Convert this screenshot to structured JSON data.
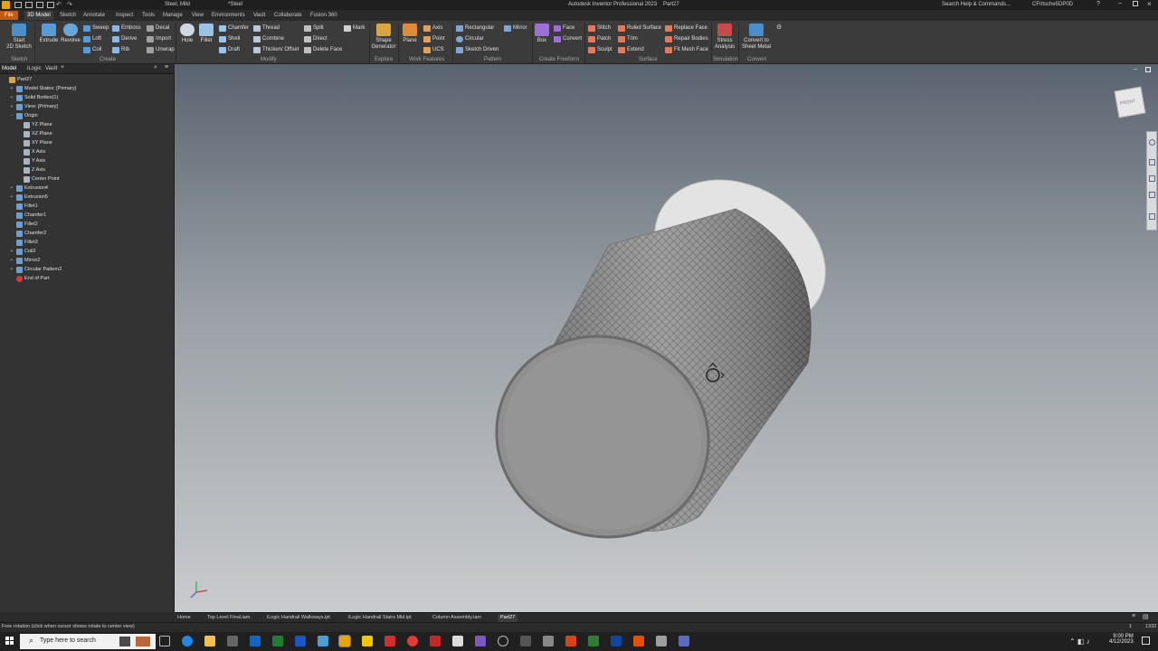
{
  "titlebar": {
    "material": "Steel, Mild",
    "appearance": "*Steel",
    "app_title": "Autodesk Inventor Professional 2023",
    "doc_title": "Part27",
    "search_placeholder": "Search Help & Commands...",
    "user": "CFritsche5DP0D"
  },
  "ribbon_tabs": [
    "File",
    "3D Model",
    "Sketch",
    "Annotate",
    "Inspect",
    "Tools",
    "Manage",
    "View",
    "Environments",
    "Vault",
    "Collaborate",
    "Fusion 360"
  ],
  "ribbon": {
    "sketch": {
      "start_label1": "Start",
      "start_label2": "2D Sketch",
      "group": "Sketch"
    },
    "create": {
      "extrude": "Extrude",
      "revolve": "Revolve",
      "sweep": "Sweep",
      "loft": "Loft",
      "coil": "Coil",
      "emboss": "Emboss",
      "derive": "Derive",
      "rib": "Rib",
      "decal": "Decal",
      "import": "Import",
      "unwrap": "Unwrap",
      "group": "Create"
    },
    "modify": {
      "hole": "Hole",
      "fillet": "Fillet",
      "chamfer": "Chamfer",
      "shell": "Shell",
      "draft": "Draft",
      "thread": "Thread",
      "combine": "Combine",
      "thicken": "Thicken/ Offset",
      "split": "Split",
      "direct": "Direct",
      "delete_face": "Delete Face",
      "mark": "Mark",
      "group": "Modify"
    },
    "explore": {
      "shape_gen1": "Shape",
      "shape_gen2": "Generator",
      "group": "Explore"
    },
    "work": {
      "plane": "Plane",
      "axis": "Axis",
      "point": "Point",
      "ucs": "UCS",
      "group": "Work Features"
    },
    "pattern": {
      "rectangular": "Rectangular",
      "circular": "Circular",
      "sketch_driven": "Sketch Driven",
      "mirror": "Mirror",
      "group": "Pattern"
    },
    "freeform": {
      "box": "Box",
      "face": "Face",
      "convert": "Convert",
      "group": "Create Freeform"
    },
    "surface": {
      "stitch": "Stitch",
      "patch": "Patch",
      "sculpt": "Sculpt",
      "ruled_surface": "Ruled Surface",
      "trim": "Trim",
      "extend": "Extend",
      "replace_face": "Replace Face",
      "repair_bodies": "Repair Bodies",
      "fit_mesh_face": "Fit Mesh Face",
      "group": "Surface"
    },
    "simulation": {
      "stress1": "Stress",
      "stress2": "Analysis",
      "group": "Simulation"
    },
    "convert": {
      "sheet1": "Convert to",
      "sheet2": "Sheet Metal",
      "group": "Convert"
    }
  },
  "browser": {
    "tabs": [
      "Model",
      "iLogic",
      "Vault"
    ],
    "tree": [
      {
        "label": "Part27",
        "indent": 0,
        "exp": ""
      },
      {
        "label": "Model States: [Primary]",
        "indent": 1,
        "exp": "+"
      },
      {
        "label": "Solid Bodies(1)",
        "indent": 1,
        "exp": "+"
      },
      {
        "label": "View: [Primary]",
        "indent": 1,
        "exp": "+"
      },
      {
        "label": "Origin",
        "indent": 1,
        "exp": "−"
      },
      {
        "label": "YZ Plane",
        "indent": 2,
        "exp": ""
      },
      {
        "label": "XZ Plane",
        "indent": 2,
        "exp": ""
      },
      {
        "label": "XY Plane",
        "indent": 2,
        "exp": ""
      },
      {
        "label": "X Axis",
        "indent": 2,
        "exp": ""
      },
      {
        "label": "Y Axis",
        "indent": 2,
        "exp": ""
      },
      {
        "label": "Z Axis",
        "indent": 2,
        "exp": ""
      },
      {
        "label": "Center Point",
        "indent": 2,
        "exp": ""
      },
      {
        "label": "Extrusion4",
        "indent": 1,
        "exp": "+"
      },
      {
        "label": "Extrusion5",
        "indent": 1,
        "exp": "+"
      },
      {
        "label": "Fillet1",
        "indent": 1,
        "exp": ""
      },
      {
        "label": "Chamfer1",
        "indent": 1,
        "exp": ""
      },
      {
        "label": "Fillet2",
        "indent": 1,
        "exp": ""
      },
      {
        "label": "Chamfer2",
        "indent": 1,
        "exp": ""
      },
      {
        "label": "Fillet3",
        "indent": 1,
        "exp": ""
      },
      {
        "label": "Coil2",
        "indent": 1,
        "exp": "+"
      },
      {
        "label": "Mirror2",
        "indent": 1,
        "exp": "+"
      },
      {
        "label": "Circular Pattern2",
        "indent": 1,
        "exp": "+"
      },
      {
        "label": "End of Part",
        "indent": 1,
        "exp": ""
      }
    ]
  },
  "viewcube_label": "FRONT",
  "doc_tabs": [
    "Home",
    "Top Level Final.iam",
    "iLogic Handrail Walkways.ipt",
    "iLogic Handrail Stairs Mid.ipt",
    "Column Assembly.iam",
    "Part27"
  ],
  "status": {
    "message": "Free rotation (click when cursor shows rotate to center view)",
    "num1": "1",
    "num2": "1332"
  },
  "taskbar": {
    "search_placeholder": "Type here to search",
    "time": "9:00 PM",
    "date": "4/12/2023"
  },
  "colors": {
    "accent_file": "#c45a14",
    "viewport_top": "#5a6470",
    "viewport_bottom": "#c9cbcd"
  }
}
